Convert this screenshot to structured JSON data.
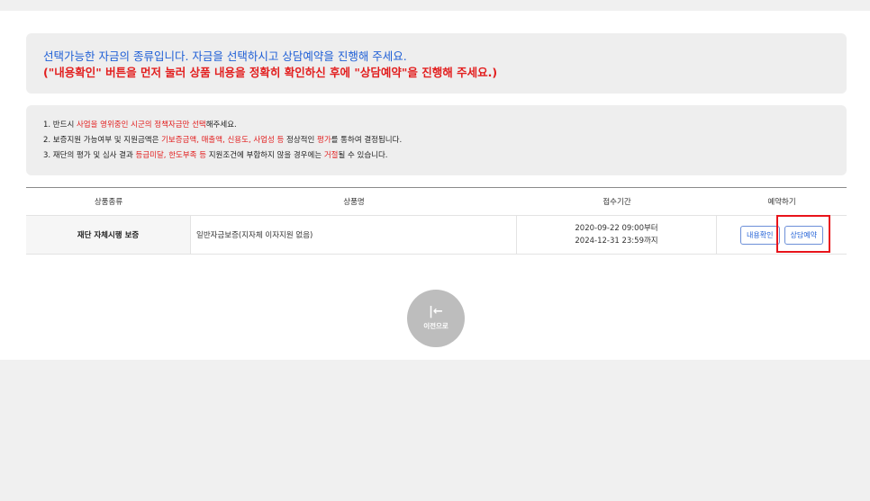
{
  "notice_top": {
    "line1": "선택가능한 자금의 종류입니다. 자금을 선택하시고 상담예약을 진행해 주세요.",
    "line2": "(\"내용확인\" 버튼을 먼저 눌러 상품 내용을 정확히 확인하신 후에 \"상담예약\"을 진행해 주세요.)"
  },
  "notice_rules": [
    {
      "segments": [
        {
          "text": "1. 반드시 ",
          "red": false
        },
        {
          "text": "사업을 영위중인 시군의 정책자금만 선택",
          "red": true
        },
        {
          "text": "해주세요.",
          "red": false
        }
      ]
    },
    {
      "segments": [
        {
          "text": "2. 보증지원 가능여부 및 지원금액은 ",
          "red": false
        },
        {
          "text": "기보증금액, 매출액, 신용도, 사업성 등",
          "red": true
        },
        {
          "text": " 정상적인 ",
          "red": false
        },
        {
          "text": "평가",
          "red": true
        },
        {
          "text": "를 통하여 결정됩니다.",
          "red": false
        }
      ]
    },
    {
      "segments": [
        {
          "text": "3. 재단의 평가 및 심사 결과 ",
          "red": false
        },
        {
          "text": "등급미달, 한도부족 등",
          "red": true
        },
        {
          "text": " 지원조건에 부합하지 않을 경우에는 ",
          "red": false
        },
        {
          "text": "거절",
          "red": true
        },
        {
          "text": "될 수 있습니다.",
          "red": false
        }
      ]
    }
  ],
  "table": {
    "headers": [
      "상품종류",
      "상품명",
      "접수기간",
      "예약하기"
    ],
    "rows": [
      {
        "type": "재단 자체시행 보증",
        "name": "일반자금보증(지자체 이자지원 없음)",
        "period_start": "2020-09-22 09:00부터",
        "period_end": "2024-12-31 23:59까지",
        "btn_detail": "내용확인",
        "btn_reserve": "상담예약"
      }
    ]
  },
  "back_button": {
    "label": "이전으로",
    "icon": "back-arrow-icon"
  },
  "colors": {
    "blue": "#1f5fd6",
    "red": "#e21e1e",
    "highlight": "#e8141b"
  }
}
